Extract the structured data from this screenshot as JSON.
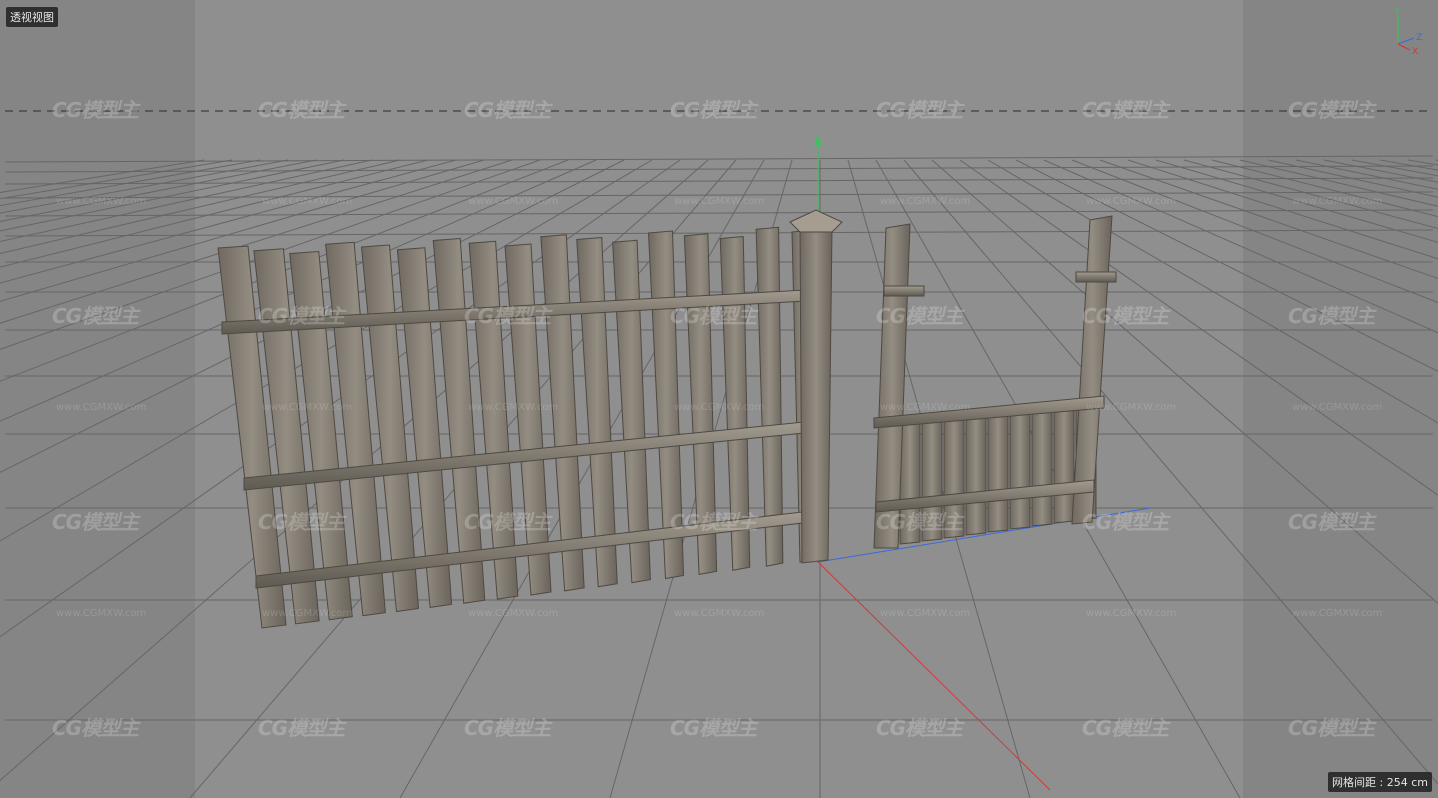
{
  "viewport": {
    "view_label": "透视视图",
    "grid_spacing": "网格间距 : 254 cm"
  },
  "gizmo": {
    "y": "Y",
    "z": "Z",
    "x": "X"
  },
  "watermark": {
    "brand": "CG模型主",
    "site": "www.CGMXW.com"
  },
  "colors": {
    "background": "#8f8f8f",
    "grid_line": "#6a6a6a",
    "horizon_dash": "#2a2a2a",
    "axis_x": "#d23a3a",
    "axis_y": "#3fbf5f",
    "axis_z": "#3a6ad8",
    "wood": "#8b847a",
    "wood_dark": "#5e5850"
  }
}
